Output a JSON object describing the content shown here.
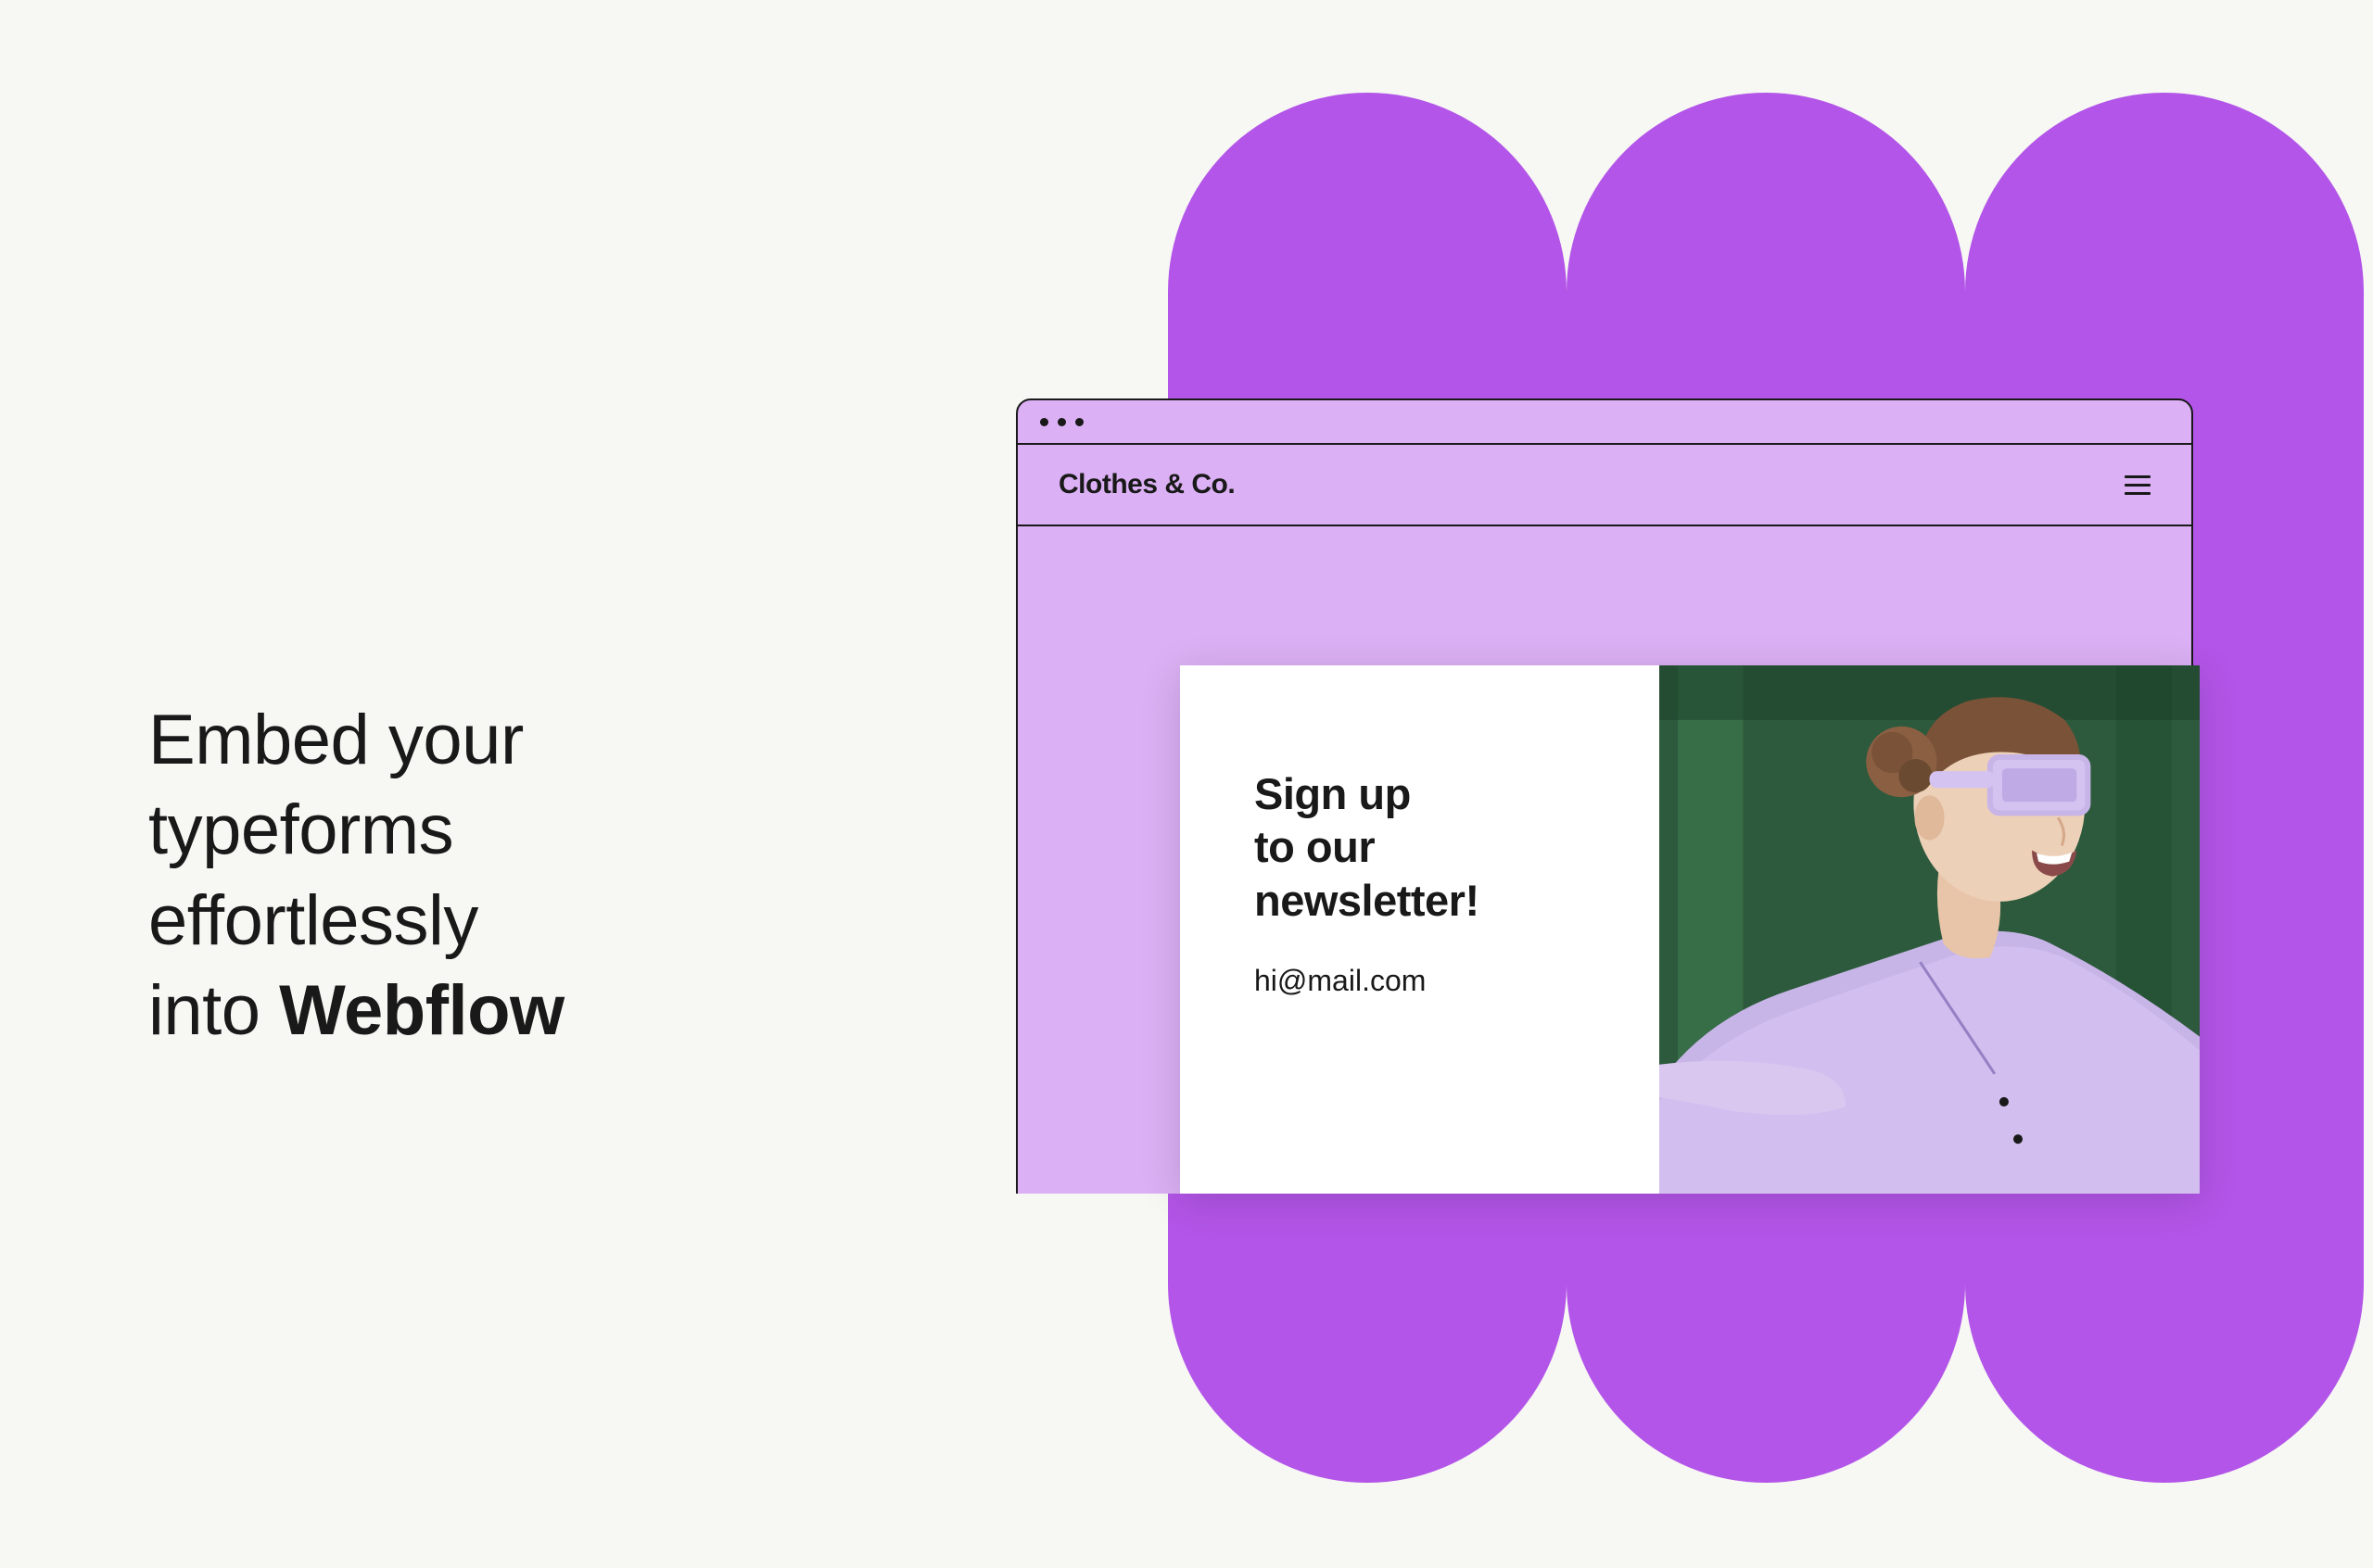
{
  "headline": {
    "line1": "Embed your",
    "line2": "typeforms",
    "line3": "effortlessly",
    "line4_prefix": "into ",
    "line4_bold": "Webflow"
  },
  "browser": {
    "brand": "Clothes & Co.",
    "newsletter_title": "Sign up\nto our\nnewsletter!",
    "email_placeholder": "hi@mail.com"
  },
  "colors": {
    "accent_purple": "#b355e8",
    "light_purple": "#dbb0f4",
    "text": "#191919",
    "background": "#f7f7f4"
  }
}
